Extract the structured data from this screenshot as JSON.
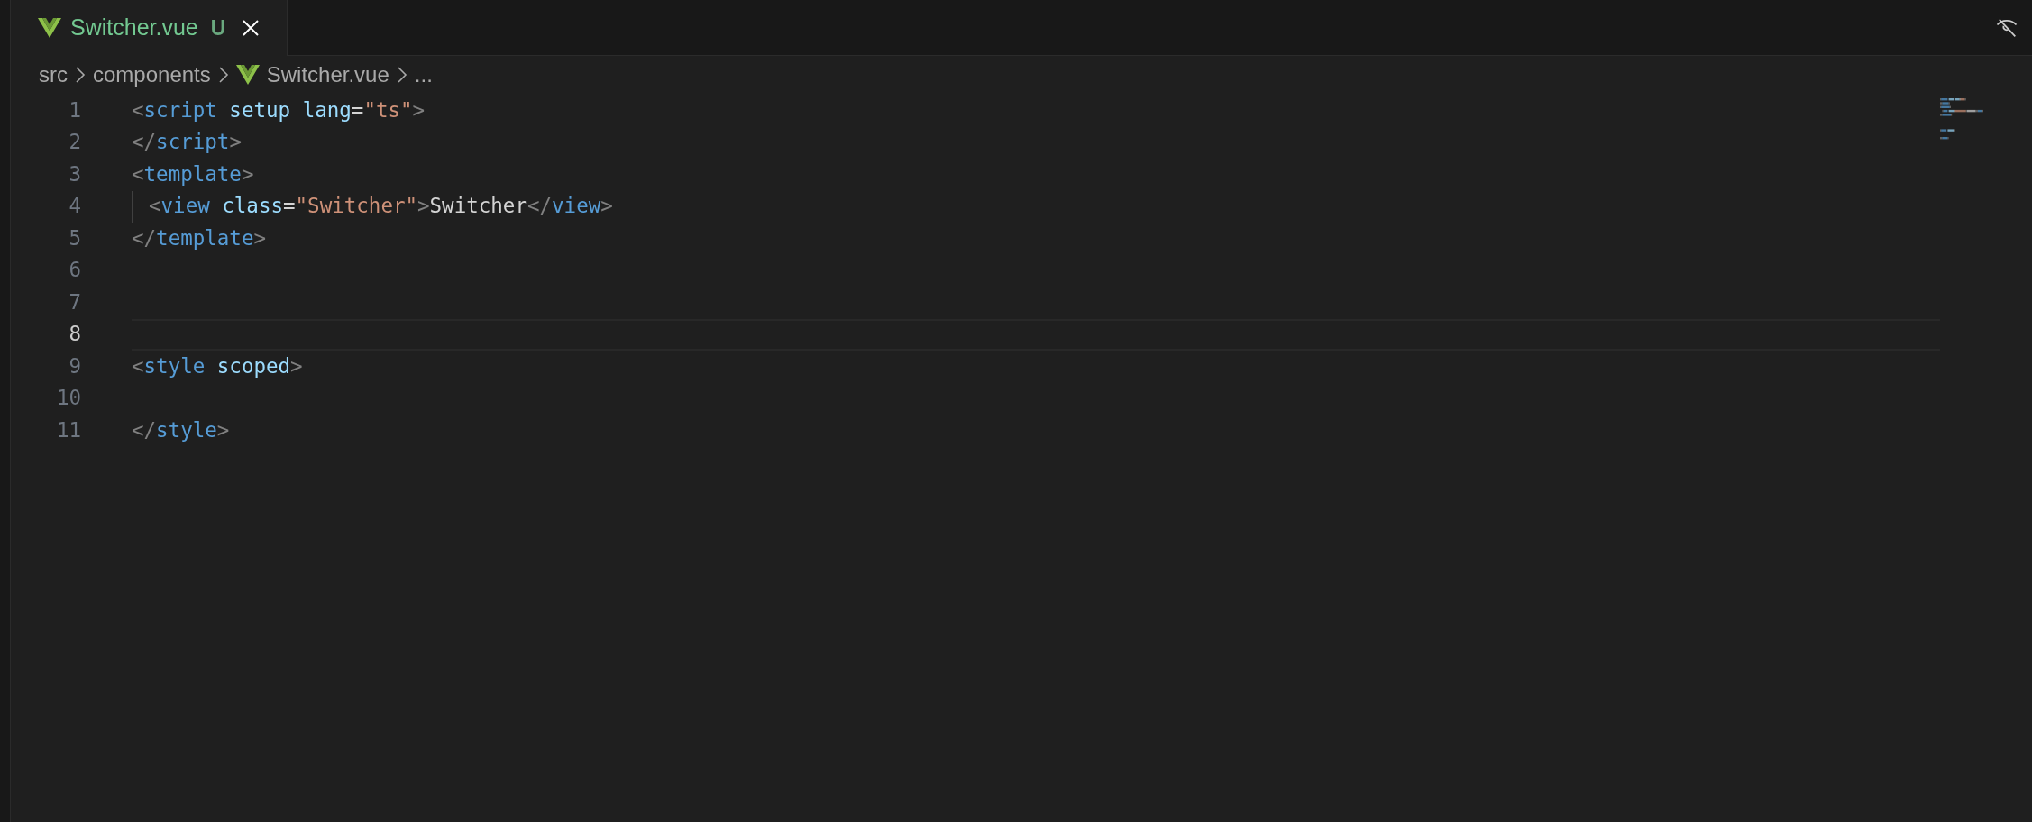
{
  "tabs": [
    {
      "label": "Switcher.vue",
      "badge": "U",
      "selected": true
    }
  ],
  "breadcrumb": [
    {
      "kind": "folder",
      "text": "src"
    },
    {
      "kind": "folder",
      "text": "components"
    },
    {
      "kind": "file",
      "text": "Switcher.vue"
    },
    {
      "kind": "more",
      "text": "..."
    }
  ],
  "editor": {
    "lines": [
      {
        "number": "1",
        "active": false,
        "indent_guide": false,
        "tokens": [
          {
            "kind": "punct",
            "text": "<"
          },
          {
            "kind": "tag",
            "text": "script"
          },
          {
            "kind": "attr",
            "text": " setup"
          },
          {
            "kind": "attr",
            "text": " lang"
          },
          {
            "kind": "text",
            "text": "="
          },
          {
            "kind": "string",
            "text": "\"ts\""
          },
          {
            "kind": "punct",
            "text": ">"
          }
        ]
      },
      {
        "number": "2",
        "active": false,
        "indent_guide": false,
        "tokens": [
          {
            "kind": "punct",
            "text": "</"
          },
          {
            "kind": "tag",
            "text": "script"
          },
          {
            "kind": "punct",
            "text": ">"
          }
        ]
      },
      {
        "number": "3",
        "active": false,
        "indent_guide": false,
        "tokens": [
          {
            "kind": "punct",
            "text": "<"
          },
          {
            "kind": "tag",
            "text": "template"
          },
          {
            "kind": "punct",
            "text": ">"
          }
        ]
      },
      {
        "number": "4",
        "active": false,
        "indent_guide": true,
        "tokens": [
          {
            "kind": "punct",
            "text": "<"
          },
          {
            "kind": "tag",
            "text": "view"
          },
          {
            "kind": "attr",
            "text": " class"
          },
          {
            "kind": "text",
            "text": "="
          },
          {
            "kind": "string",
            "text": "\"Switcher\""
          },
          {
            "kind": "punct",
            "text": ">"
          },
          {
            "kind": "text",
            "text": "Switcher"
          },
          {
            "kind": "punct",
            "text": "</"
          },
          {
            "kind": "tag",
            "text": "view"
          },
          {
            "kind": "punct",
            "text": ">"
          }
        ]
      },
      {
        "number": "5",
        "active": false,
        "indent_guide": false,
        "tokens": [
          {
            "kind": "punct",
            "text": "</"
          },
          {
            "kind": "tag",
            "text": "template"
          },
          {
            "kind": "punct",
            "text": ">"
          }
        ]
      },
      {
        "number": "6",
        "active": false,
        "indent_guide": false
      },
      {
        "number": "7",
        "active": false,
        "indent_guide": false
      },
      {
        "number": "8",
        "active": true,
        "indent_guide": false
      },
      {
        "number": "9",
        "active": false,
        "indent_guide": false,
        "tokens": [
          {
            "kind": "punct",
            "text": "<"
          },
          {
            "kind": "tag",
            "text": "style"
          },
          {
            "kind": "attr",
            "text": " scoped"
          },
          {
            "kind": "punct",
            "text": ">"
          }
        ]
      },
      {
        "number": "10",
        "active": false,
        "indent_guide": false
      },
      {
        "number": "11",
        "active": false,
        "indent_guide": false,
        "tokens": [
          {
            "kind": "punct",
            "text": "</"
          },
          {
            "kind": "tag",
            "text": "style"
          },
          {
            "kind": "punct",
            "text": ">"
          }
        ]
      }
    ]
  }
}
